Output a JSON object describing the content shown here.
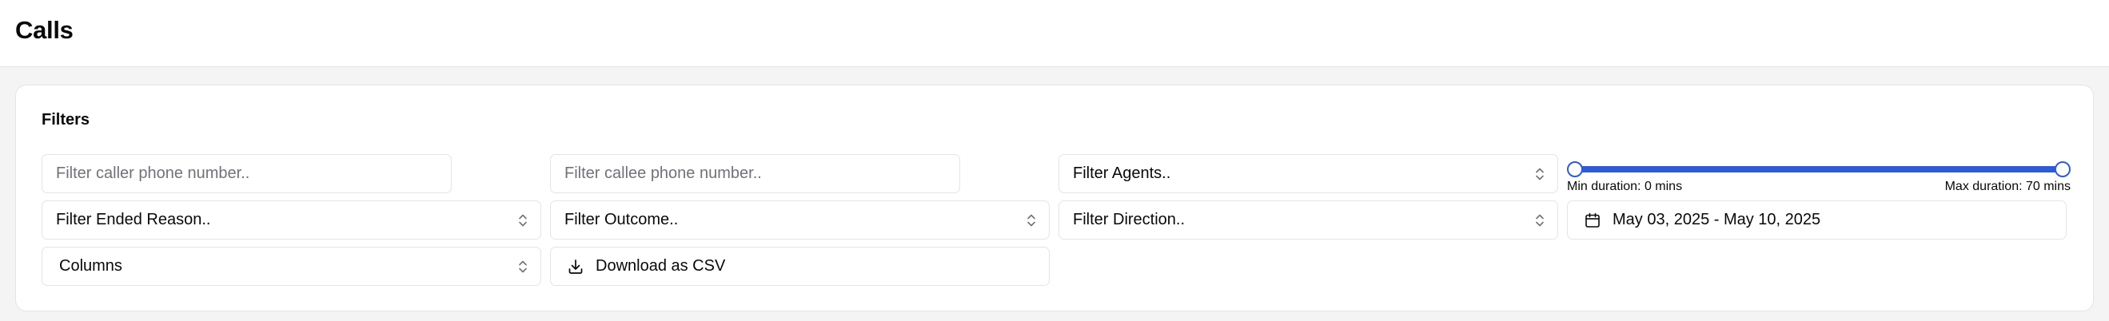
{
  "page": {
    "title": "Calls"
  },
  "filters": {
    "title": "Filters",
    "caller_phone": {
      "placeholder": "Filter caller phone number..",
      "value": ""
    },
    "callee_phone": {
      "placeholder": "Filter callee phone number..",
      "value": ""
    },
    "agents": {
      "label": "Filter Agents.."
    },
    "duration": {
      "min_label": "Min duration: 0 mins",
      "max_label": "Max duration: 70 mins",
      "min_value": 0,
      "max_value": 70,
      "range_min": 0,
      "range_max": 70,
      "accent_color": "#2f5bd8"
    },
    "ended_reason": {
      "label": "Filter Ended Reason.."
    },
    "outcome": {
      "label": "Filter Outcome.."
    },
    "direction": {
      "label": "Filter Direction.."
    },
    "date_range": {
      "label": "May 03, 2025 - May 10, 2025",
      "icon": "calendar-icon"
    },
    "columns": {
      "label": "Columns"
    },
    "download": {
      "label": "Download as CSV",
      "icon": "download-icon"
    }
  }
}
